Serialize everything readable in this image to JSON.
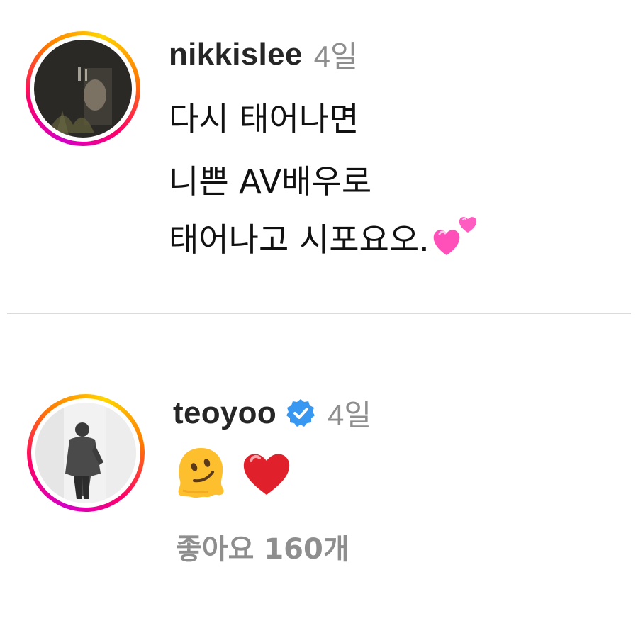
{
  "comments": [
    {
      "username": "nikkislee",
      "time": "4일",
      "lines": [
        "다시 태어나면",
        "니쁜 AV배우로",
        "태어나고 시포요오."
      ],
      "trailing_emoji": "two-hearts-icon",
      "verified": false,
      "avatar_ring_style": "story-gradient"
    },
    {
      "username": "teoyoo",
      "time": "4일",
      "emojis": [
        "melting-face-icon",
        "red-heart-icon"
      ],
      "verified": true,
      "likes_label": "좋아요 160개",
      "avatar_ring_style": "story-gradient"
    }
  ],
  "colors": {
    "username": "#262626",
    "secondary_text": "#8e8e8e",
    "divider": "#dbdbdb",
    "verified_badge": "#3897f0",
    "heart_red": "#e0202a",
    "heart_pink": "#ff4fb8"
  }
}
